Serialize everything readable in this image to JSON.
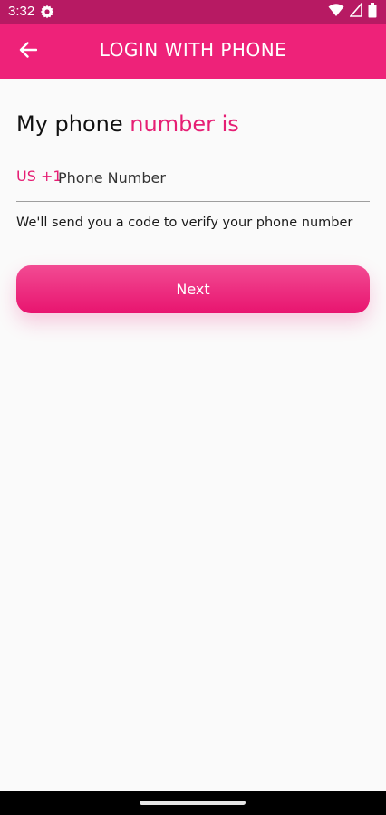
{
  "status_bar": {
    "time": "3:32",
    "icons": [
      "gear-icon",
      "wifi-icon",
      "signal-icon",
      "battery-icon"
    ]
  },
  "app_bar": {
    "title": "LOGIN WITH PHONE",
    "back_icon": "arrow-back-icon"
  },
  "heading": {
    "prefix": "My phone ",
    "highlight": "number is"
  },
  "phone_field": {
    "country_code": "US +1",
    "placeholder": "Phone Number",
    "value": ""
  },
  "helper_text": "We'll send you a code to verify your phone number",
  "next_button": {
    "label": "Next"
  },
  "colors": {
    "status_bar": "#b71a63",
    "app_bar": "#ee2279",
    "accent": "#e61e74",
    "background": "#fafafa"
  }
}
